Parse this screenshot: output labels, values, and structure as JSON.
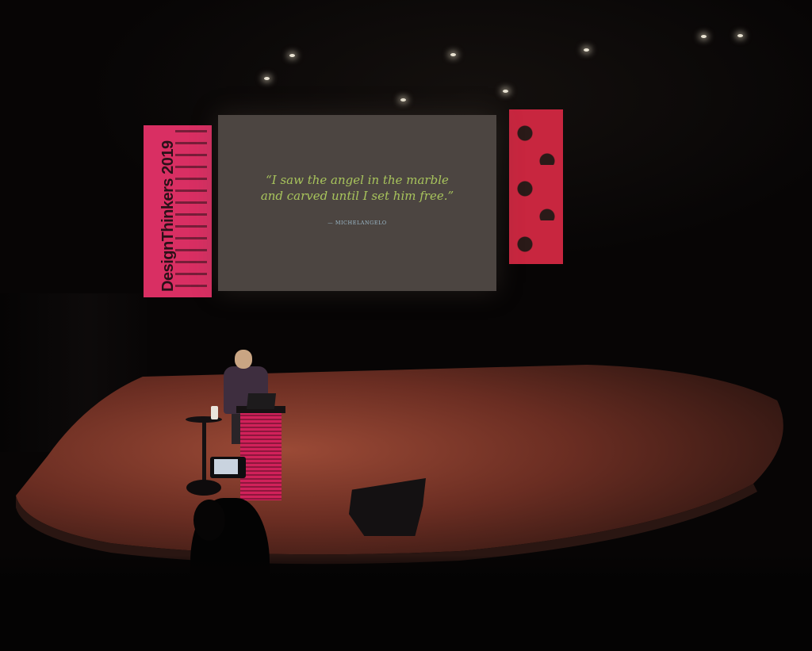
{
  "screen": {
    "quote_line1": "“I saw the angel in the marble",
    "quote_line2": "and carved until I set him free.”",
    "attribution": "— MICHELANGELO"
  },
  "banner": {
    "brand": "DesignThinkers 2019"
  },
  "colors": {
    "banner_pink": "#d92f63",
    "quote_green": "#a8c45c",
    "screen_bg": "#4c4541",
    "stage_wood": "#7a3a2c"
  }
}
